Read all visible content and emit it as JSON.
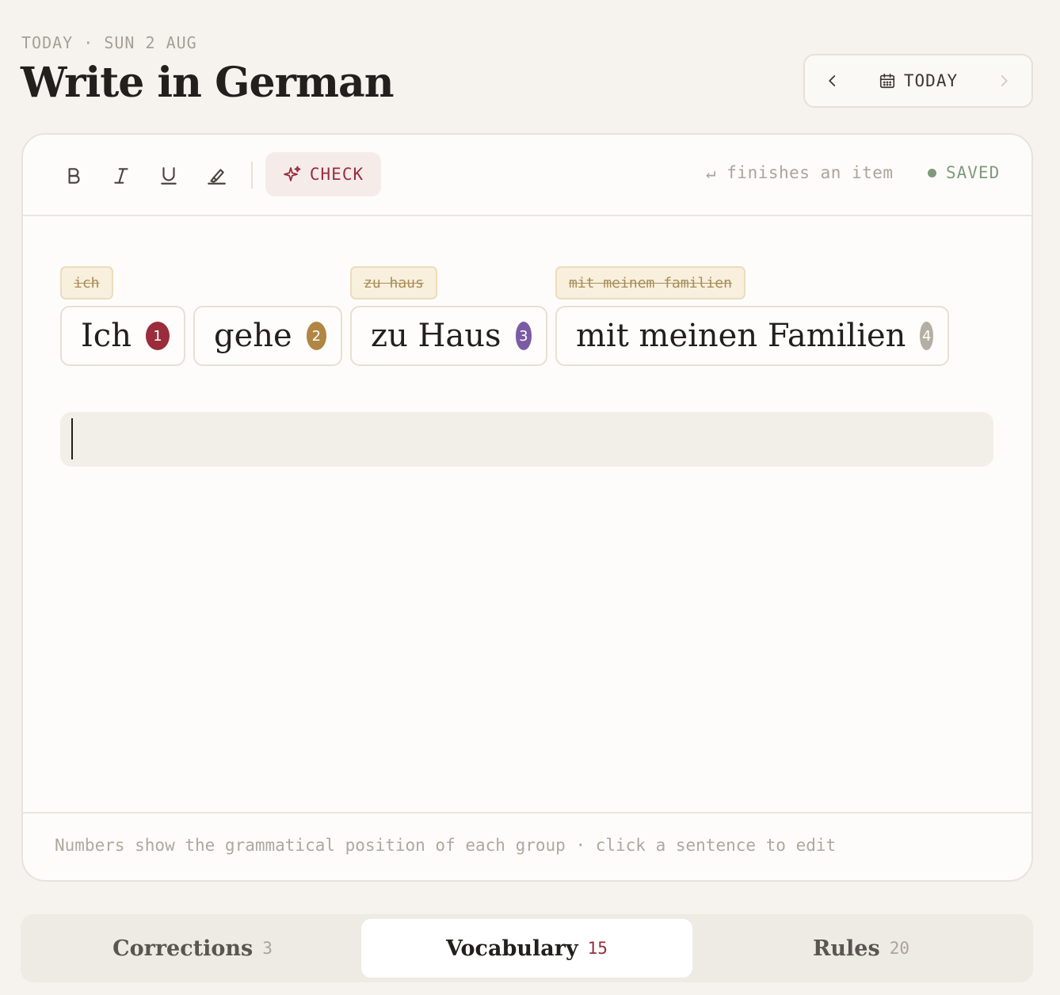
{
  "header": {
    "date_line": "TODAY · SUN 2 AUG",
    "title": "Write in German"
  },
  "date_nav": {
    "prev_icon": "chevron-left-icon",
    "today_label": "TODAY",
    "today_icon": "calendar-icon",
    "next_icon": "chevron-right-icon"
  },
  "toolbar": {
    "buttons": [
      "bold-icon",
      "italic-icon",
      "underline-icon",
      "highlighter-icon"
    ],
    "check_label": "CHECK",
    "hint": "↵ finishes an item",
    "status": "SAVED",
    "colors": {
      "check": "#9a2c3c",
      "saved": "#7f9a7c"
    }
  },
  "sentence": {
    "groups": [
      {
        "text": "Ich",
        "position": "1",
        "original": "ich",
        "color": "#9a2c3c"
      },
      {
        "text": "gehe",
        "position": "2",
        "original": "",
        "color": "#b08644"
      },
      {
        "text": "zu Haus",
        "position": "3",
        "original": "zu haus",
        "color": "#7a5ca4"
      },
      {
        "text": "mit meinen Familien",
        "position": "4",
        "original": "mit meinem familien",
        "color": "#b4aea3"
      }
    ]
  },
  "input": {
    "value": ""
  },
  "footer_note": "Numbers show the grammatical position of each group · click a sentence to edit",
  "tabs": [
    {
      "label": "Corrections",
      "count": "3",
      "active": false
    },
    {
      "label": "Vocabulary",
      "count": "15",
      "active": true
    },
    {
      "label": "Rules",
      "count": "20",
      "active": false
    }
  ]
}
